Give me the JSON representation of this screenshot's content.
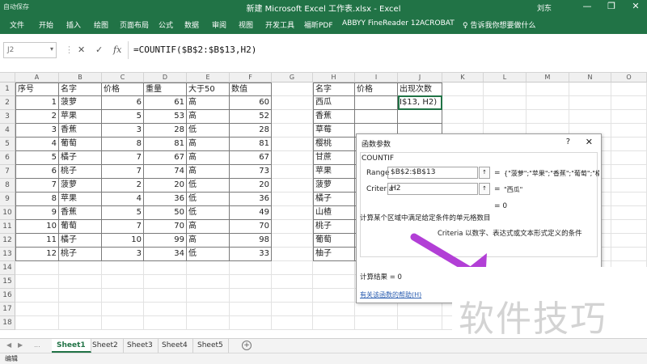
{
  "titlebar": {
    "autosave": "自动保存",
    "title": "新建 Microsoft Excel 工作表.xlsx - Excel",
    "user": "刘东",
    "minimize": "—",
    "restore": "❐",
    "close": "✕"
  },
  "ribbon": {
    "tabs": [
      "文件",
      "开始",
      "插入",
      "绘图",
      "页面布局",
      "公式",
      "数据",
      "审阅",
      "视图",
      "开发工具",
      "福昕PDF",
      "ABBYY FineReader 12",
      "ACROBAT"
    ],
    "tell_me": "告诉我你想要做什么"
  },
  "formula_bar": {
    "name_box": "J2",
    "cancel": "✕",
    "enter": "✓",
    "fx": "fx",
    "formula": "=COUNTIF($B$2:$B$13,H2)"
  },
  "columns": [
    "A",
    "B",
    "C",
    "D",
    "E",
    "F",
    "G",
    "H",
    "I",
    "J",
    "K",
    "L",
    "M",
    "N",
    "O"
  ],
  "rows": [
    "1",
    "2",
    "3",
    "4",
    "5",
    "6",
    "7",
    "8",
    "9",
    "10",
    "11",
    "12",
    "13",
    "14",
    "15",
    "16",
    "17",
    "18"
  ],
  "table_left": {
    "headers": [
      "序号",
      "名字",
      "价格",
      "重量",
      "大于50",
      "数值"
    ],
    "rows": [
      [
        "1",
        "菠萝",
        "6",
        "61",
        "高",
        "60"
      ],
      [
        "2",
        "苹果",
        "5",
        "53",
        "高",
        "52"
      ],
      [
        "3",
        "香蕉",
        "3",
        "28",
        "低",
        "28"
      ],
      [
        "4",
        "葡萄",
        "8",
        "81",
        "高",
        "81"
      ],
      [
        "5",
        "橘子",
        "7",
        "67",
        "高",
        "67"
      ],
      [
        "6",
        "桃子",
        "7",
        "74",
        "高",
        "73"
      ],
      [
        "7",
        "菠萝",
        "2",
        "20",
        "低",
        "20"
      ],
      [
        "8",
        "苹果",
        "4",
        "36",
        "低",
        "36"
      ],
      [
        "9",
        "香蕉",
        "5",
        "50",
        "低",
        "49"
      ],
      [
        "10",
        "葡萄",
        "7",
        "70",
        "高",
        "70"
      ],
      [
        "11",
        "橘子",
        "10",
        "99",
        "高",
        "98"
      ],
      [
        "12",
        "桃子",
        "3",
        "34",
        "低",
        "33"
      ]
    ]
  },
  "table_right": {
    "headers": [
      "名字",
      "价格",
      "出现次数"
    ],
    "names": [
      "西瓜",
      "香蕉",
      "草莓",
      "樱桃",
      "甘蔗",
      "苹果",
      "菠萝",
      "橘子",
      "山楂",
      "桃子",
      "葡萄",
      "柚子"
    ],
    "editing_cell": "I$13, H2)"
  },
  "dialog": {
    "title": "函数参数",
    "help": "?",
    "close": "✕",
    "function_name": "COUNTIF",
    "range_label": "Range",
    "range_value": "$B$2:$B$13",
    "range_result": "{\"菠萝\";\"苹果\";\"香蕉\";\"葡萄\";\"橘子",
    "criteria_label": "Criteria",
    "criteria_value": "H2",
    "criteria_result": "\"西瓜\"",
    "equals": "=",
    "result_zero": "= 0",
    "description": "计算某个区域中满足给定条件的单元格数目",
    "param_description": "Criteria  以数字、表达式或文本形式定义的条件",
    "calc_result": "计算结果 =   0",
    "help_link": "有关该函数的帮助(H)",
    "pick_icon": "↑"
  },
  "watermark": "软件技巧",
  "sheets": [
    "Sheet1",
    "Sheet2",
    "Sheet3",
    "Sheet4",
    "Sheet5"
  ],
  "active_sheet": "Sheet1",
  "sheet_nav": [
    "◀",
    "▶",
    "..."
  ],
  "add_sheet": "+",
  "status": {
    "mode": "编辑"
  },
  "colors": {
    "excel_green": "#217346",
    "arrow_purple": "#b23fd6"
  }
}
